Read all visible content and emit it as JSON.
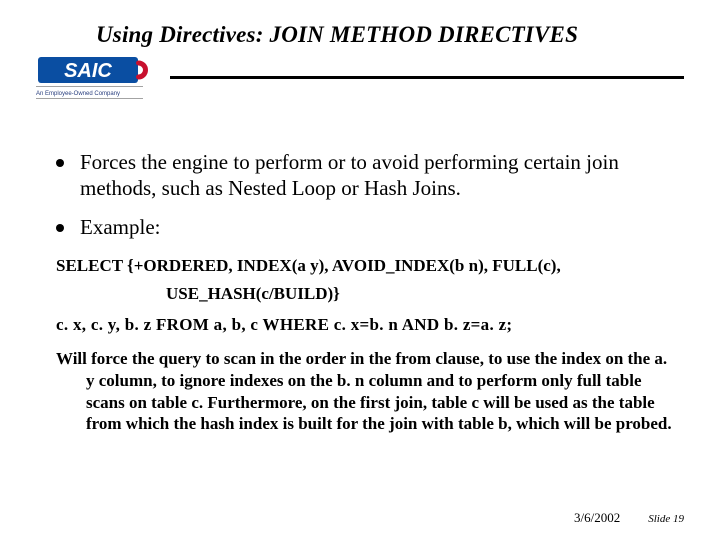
{
  "title": "Using Directives:  JOIN METHOD DIRECTIVES",
  "logo": {
    "brand": "SAIC",
    "tagline": "An Employee-Owned Company"
  },
  "bullets": [
    "Forces the engine to perform or to avoid performing certain join methods, such as Nested Loop or Hash Joins.",
    "Example:"
  ],
  "code": {
    "line1": "SELECT {+ORDERED, INDEX(a y), AVOID_INDEX(b n), FULL(c),",
    "line2": "USE_HASH(c/BUILD)}",
    "line3": "c. x, c. y, b. z FROM a, b, c WHERE c. x=b. n AND b. z=a. z;"
  },
  "explanation": "Will force the query to scan in the order in the from clause, to use the index on the a. y column, to ignore indexes on the b. n column and to perform only full table scans on table c.  Furthermore, on the first join, table c will be used as the table from which the hash index is built for the join with table b, which will be probed.",
  "footer": {
    "date": "3/6/2002",
    "slide_label": "Slide 19"
  },
  "colors": {
    "logo_blue": "#0a4ea2",
    "logo_red": "#c8102e",
    "rule": "#000000"
  }
}
